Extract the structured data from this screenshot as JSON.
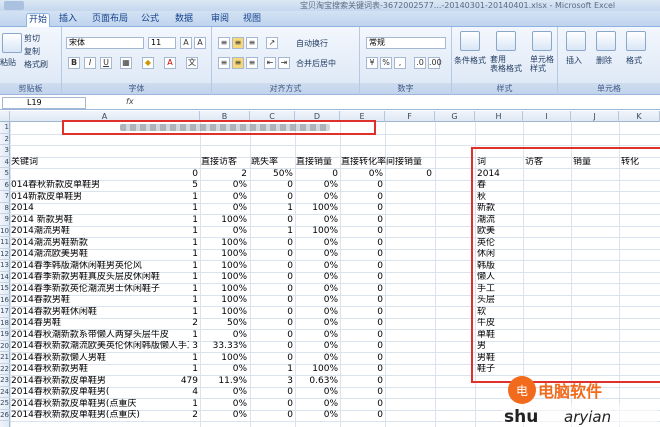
{
  "window": {
    "title": "宝贝淘宝搜索关键词表-3672002577...-20140301-20140401.xlsx - Microsoft Excel"
  },
  "tabs": [
    "开始",
    "插入",
    "页面布局",
    "公式",
    "数据",
    "审阅",
    "视图"
  ],
  "ribbon": {
    "clipboard": {
      "label": "剪贴板",
      "paste": "粘贴",
      "cut": "剪切",
      "copy": "复制",
      "format_painter": "格式刷"
    },
    "font": {
      "label": "字体",
      "name": "宋体",
      "size": "11",
      "bold": "B",
      "italic": "I",
      "underline": "U"
    },
    "alignment": {
      "label": "对齐方式",
      "wrap": "自动换行",
      "merge": "合并后居中"
    },
    "number": {
      "label": "数字",
      "format": "常规"
    },
    "styles": {
      "label": "样式",
      "conditional": "条件格式",
      "table": "套用\n表格格式",
      "cell": "单元格\n样式"
    },
    "cells": {
      "label": "单元格",
      "insert": "插入",
      "delete": "删除",
      "format": "格式"
    }
  },
  "formula_bar": {
    "name_box": "L19",
    "fx": "fx"
  },
  "columns": [
    "A",
    "B",
    "C",
    "D",
    "E",
    "F",
    "G",
    "H",
    "I",
    "J",
    "K"
  ],
  "rows": [
    "1",
    "2",
    "3",
    "4",
    "5",
    "6",
    "7",
    "8",
    "9",
    "10",
    "11",
    "12",
    "13",
    "14",
    "15",
    "16",
    "17",
    "18",
    "19",
    "20",
    "21",
    "22",
    "23",
    "24",
    "25",
    "26"
  ],
  "headers": {
    "a": "关键词",
    "b": "直接访客",
    "c": "跳失率",
    "d": "直接销量",
    "e": "直接转化率",
    "f": "间接销量"
  },
  "table": [
    [
      "",
      "0",
      "2",
      "50%",
      "0",
      "0%",
      "0"
    ],
    [
      "014春秋新款皮单鞋男",
      "5",
      "0%",
      "0",
      "0%",
      "0"
    ],
    [
      "014新款皮单鞋男",
      "1",
      "0%",
      "0",
      "0%",
      "0"
    ],
    [
      "2014",
      "1",
      "0%",
      "1",
      "100%",
      "0"
    ],
    [
      "2014 新款男鞋",
      "1",
      "100%",
      "0",
      "0%",
      "0"
    ],
    [
      "2014潮流男鞋",
      "1",
      "0%",
      "1",
      "100%",
      "0"
    ],
    [
      "2014潮流男鞋新款",
      "1",
      "100%",
      "0",
      "0%",
      "0"
    ],
    [
      "2014潮流欧美男鞋",
      "1",
      "100%",
      "0",
      "0%",
      "0"
    ],
    [
      "2014春季韩版潮休闲鞋男英伦风",
      "1",
      "100%",
      "0",
      "0%",
      "0"
    ],
    [
      "2014春季新款男鞋真皮头层皮休闲鞋",
      "1",
      "100%",
      "0",
      "0%",
      "0"
    ],
    [
      "2014春季新款英伦潮流男士休闲鞋子",
      "1",
      "100%",
      "0",
      "0%",
      "0"
    ],
    [
      "2014春款男鞋",
      "1",
      "100%",
      "0",
      "0%",
      "0"
    ],
    [
      "2014春款男鞋休闲鞋",
      "1",
      "100%",
      "0",
      "0%",
      "0"
    ],
    [
      "2014春男鞋",
      "2",
      "50%",
      "0",
      "0%",
      "0"
    ],
    [
      "2014春秋潮新款系带懒人两穿头层牛皮",
      "1",
      "0%",
      "0",
      "0%",
      "0"
    ],
    [
      "2014春秋新款潮流欧美英伦休闲韩版懒人手工",
      "3",
      "33.33%",
      "0",
      "0%",
      "0"
    ],
    [
      "2014春秋新款懒人男鞋",
      "1",
      "100%",
      "0",
      "0%",
      "0"
    ],
    [
      "2014春秋新款男鞋",
      "1",
      "0%",
      "1",
      "100%",
      "0"
    ],
    [
      "2014春秋新款皮单鞋男",
      "479",
      "11.9%",
      "3",
      "0.63%",
      "0"
    ],
    [
      "2014春秋新款皮单鞋男(",
      "4",
      "0%",
      "0",
      "0%",
      "0"
    ],
    [
      "2014春秋新款皮单鞋男(点重庆",
      "1",
      "0%",
      "0",
      "0%",
      "0"
    ],
    [
      "2014春秋新款皮单鞋男(点重庆)",
      "2",
      "0%",
      "0",
      "0%",
      "0"
    ]
  ],
  "right_headers": {
    "h": "词",
    "i": "访客",
    "j": "销量",
    "k": "转化"
  },
  "right_words": [
    "2014",
    "春",
    "秋",
    "新款",
    "潮流",
    "欧美",
    "英伦",
    "休闲",
    "韩版",
    "懒人",
    "手工",
    "头层",
    "软",
    "牛皮",
    "单鞋",
    "男",
    "男鞋",
    "鞋子"
  ],
  "watermark": {
    "text1": "电脑软件",
    "text2": "shu",
    "text3": "aryian"
  }
}
